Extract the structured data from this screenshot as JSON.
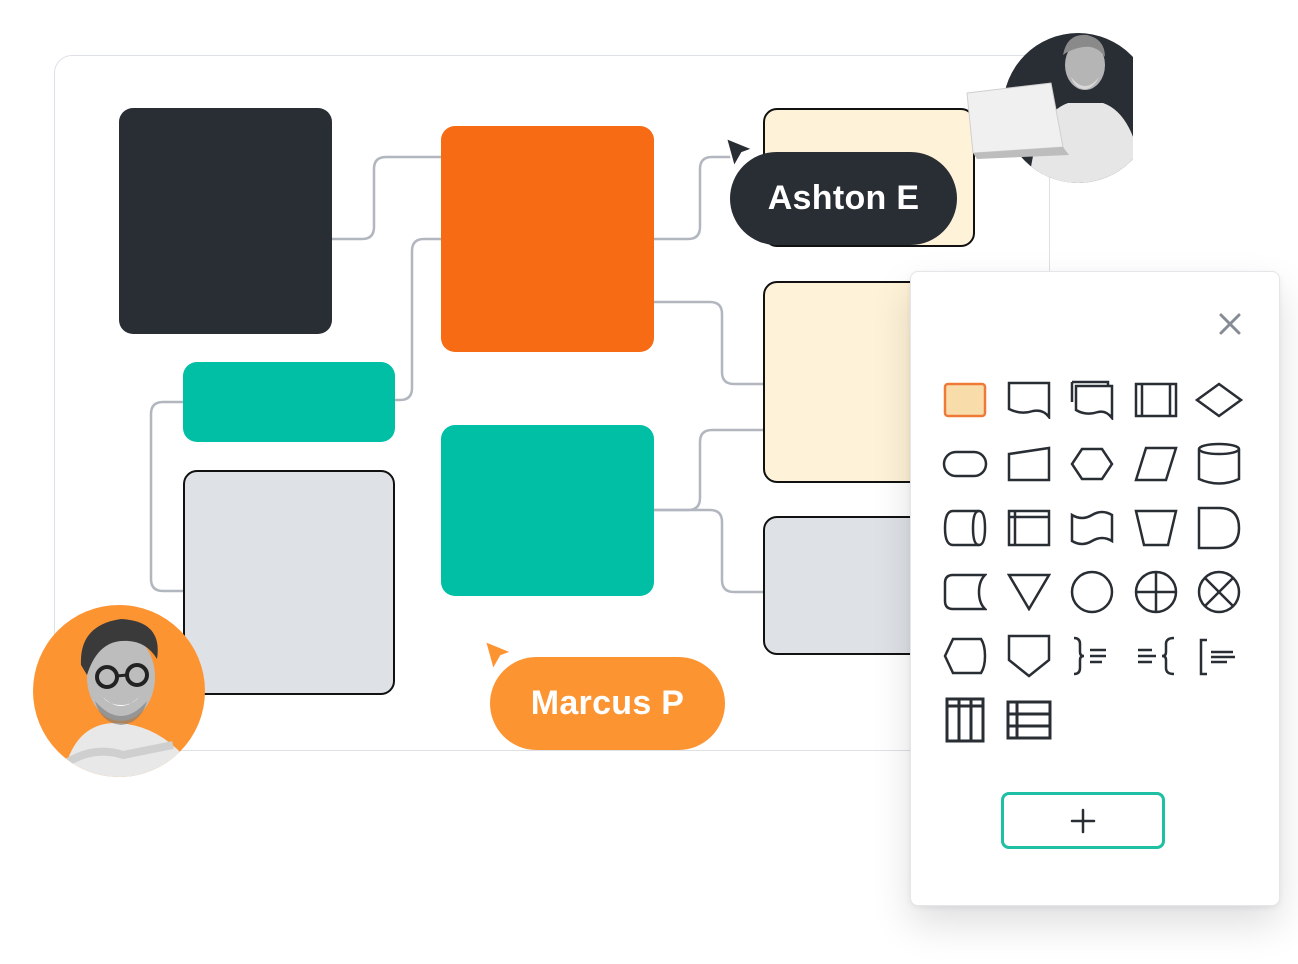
{
  "canvas": {
    "shapes": [
      {
        "id": "dark-block",
        "fill": "#292d34"
      },
      {
        "id": "orange-block",
        "fill": "#f76b15"
      },
      {
        "id": "teal-small-block",
        "fill": "#00bfa5"
      },
      {
        "id": "teal-block",
        "fill": "#00bfa5"
      },
      {
        "id": "grey-left-block",
        "fill": "#dee1e6"
      },
      {
        "id": "cream-top-block",
        "fill": "#fef2d8"
      },
      {
        "id": "cream-mid-block",
        "fill": "#fef2d8"
      },
      {
        "id": "grey-right-block",
        "fill": "#dee1e6"
      }
    ],
    "connector_color": "#b1b6bf"
  },
  "collaborators": [
    {
      "name": "Ashton E",
      "color": "#292d34",
      "avatar_bg": "#292d34"
    },
    {
      "name": "Marcus P",
      "color": "#fd9432",
      "avatar_bg": "#fd9432"
    }
  ],
  "shape_panel": {
    "close_icon": "close-icon",
    "add_icon": "plus-icon",
    "accent": "#1ebfa3",
    "selected_fill": "#f8dcaa",
    "selected_stroke": "#ef7a37",
    "shapes": [
      "process",
      "document",
      "multi-document",
      "predefined-process",
      "decision",
      "terminator",
      "manual-input",
      "preparation",
      "data",
      "database",
      "direct-access-storage",
      "internal-storage",
      "punched-tape",
      "manual-operation",
      "delay",
      "stored-data",
      "merge",
      "connector",
      "or",
      "summing-junction",
      "display",
      "off-page-connector",
      "annotation-right",
      "annotation-left",
      "annotation-bracket",
      "vertical-table",
      "horizontal-table"
    ]
  }
}
